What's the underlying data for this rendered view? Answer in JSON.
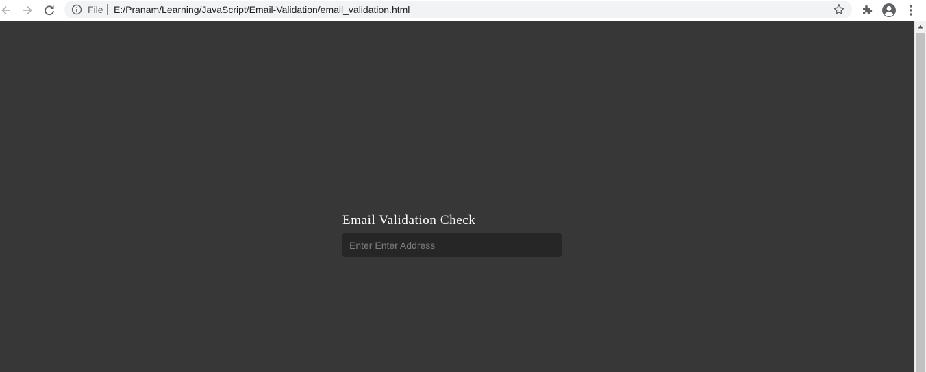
{
  "browser": {
    "scheme_label": "File",
    "url": "E:/Pranam/Learning/JavaScript/Email-Validation/email_validation.html",
    "icons": {
      "back": "arrow-left-icon",
      "forward": "arrow-right-icon",
      "reload": "reload-icon",
      "info": "info-icon",
      "bookmark": "star-icon",
      "extensions": "puzzle-icon",
      "profile": "account-circle-icon",
      "menu": "kebab-menu-icon"
    }
  },
  "page": {
    "title": "Email Validation Check",
    "input": {
      "value": "",
      "placeholder": "Enter Enter Address"
    },
    "colors": {
      "background": "#373737",
      "input_background": "#262626",
      "title_text": "#ffffff",
      "placeholder_text": "#7d7d7d"
    }
  }
}
